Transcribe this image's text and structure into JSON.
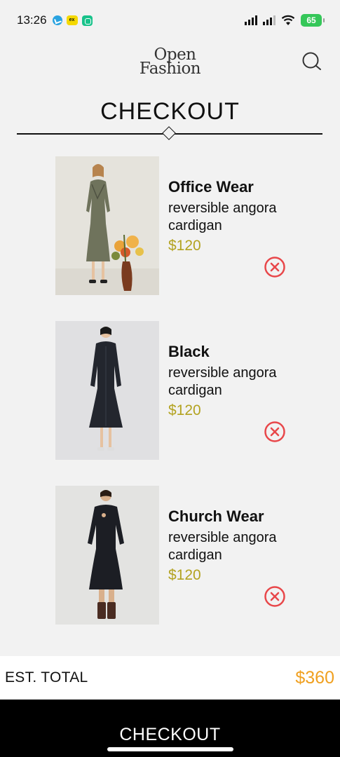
{
  "status_bar": {
    "time": "13:26",
    "yellow_app_text": "ex",
    "battery": "65",
    "icons": [
      "telegram-icon",
      "yellow-app-icon",
      "green-app-icon",
      "signal-icon",
      "signal-icon",
      "wifi-icon",
      "battery-icon"
    ]
  },
  "header": {
    "logo_line1": "Open",
    "logo_line2": "Fashion",
    "search_icon": "search-icon"
  },
  "page_title": "CHECKOUT",
  "cart": {
    "items": [
      {
        "name": "Office Wear",
        "description": "reversible angora cardigan",
        "price": "$120",
        "remove_icon": "close-circle-icon"
      },
      {
        "name": "Black",
        "description": "reversible angora cardigan",
        "price": "$120",
        "remove_icon": "close-circle-icon"
      },
      {
        "name": "Church Wear",
        "description": "reversible angora cardigan",
        "price": "$120",
        "remove_icon": "close-circle-icon"
      }
    ]
  },
  "total": {
    "label": "EST. TOTAL",
    "value": "$360"
  },
  "checkout_button": "CHECKOUT",
  "colors": {
    "background": "#f2f2f2",
    "price": "#b3a321",
    "total": "#f0a020",
    "remove": "#e8474a",
    "button": "#000000"
  }
}
